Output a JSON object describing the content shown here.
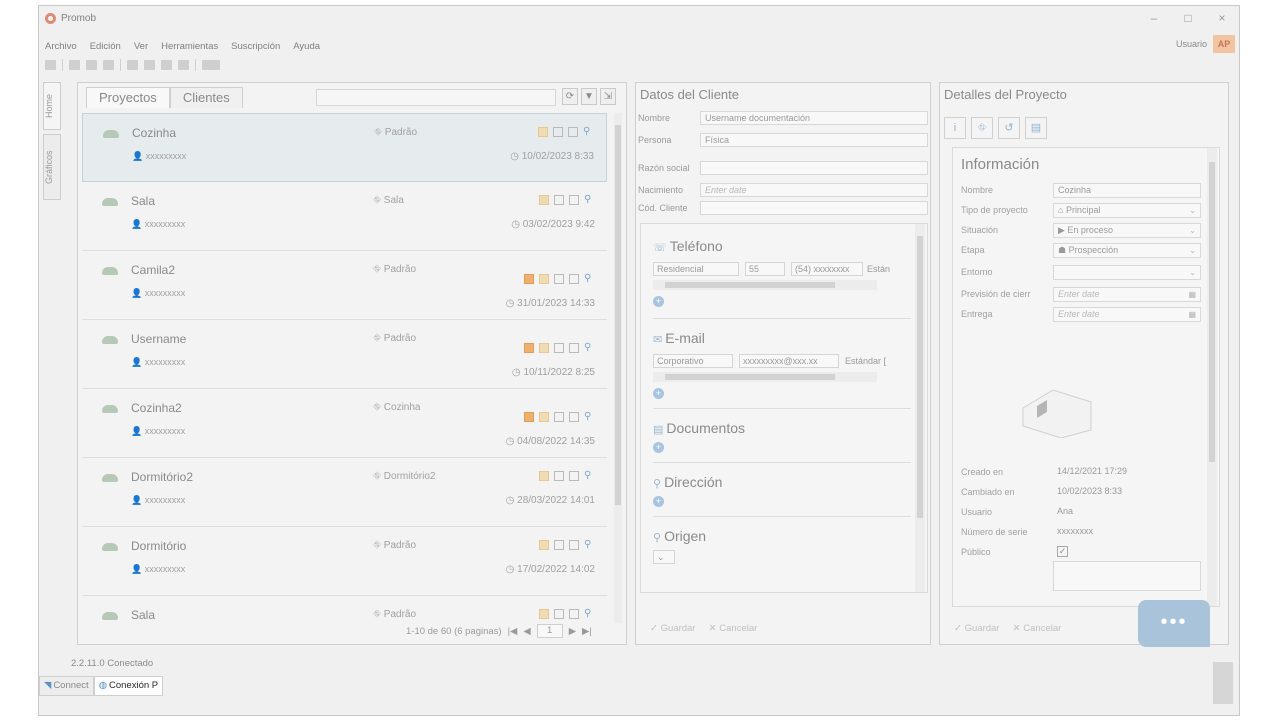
{
  "window": {
    "title": "Promob",
    "controls": [
      "–",
      "□",
      "×"
    ]
  },
  "menu": [
    "Archivo",
    "Edición",
    "Ver",
    "Herramientas",
    "Suscripción",
    "Ayuda"
  ],
  "user": {
    "label": "Usuario",
    "avatar": "AP"
  },
  "side_tabs": {
    "home": "Home",
    "graficos": "Gráficos"
  },
  "projects": {
    "tabs": [
      "Proyectos",
      "Clientes"
    ],
    "rows": [
      {
        "name": "Cozinha",
        "owner": "xxxxxxxxx",
        "environment": "Padrão",
        "date": "10/02/2023 8:33",
        "selected": true,
        "person": false
      },
      {
        "name": "Sala",
        "owner": "xxxxxxxxx",
        "environment": "Sala",
        "date": "03/02/2023 9:42",
        "selected": false,
        "person": false
      },
      {
        "name": "Camila2",
        "owner": "xxxxxxxxx",
        "environment": "Padrão",
        "date": "31/01/2023 14:33",
        "selected": false,
        "person": true
      },
      {
        "name": "Username",
        "owner": "xxxxxxxxx",
        "environment": "Padrão",
        "date": "10/11/2022 8:25",
        "selected": false,
        "person": true
      },
      {
        "name": "Cozinha2",
        "owner": "xxxxxxxxx",
        "environment": "Cozinha",
        "date": "04/08/2022 14:35",
        "selected": false,
        "person": true
      },
      {
        "name": "Dormitório2",
        "owner": "xxxxxxxxx",
        "environment": "Dormitório2",
        "date": "28/03/2022 14:01",
        "selected": false,
        "person": false
      },
      {
        "name": "Dormitório",
        "owner": "xxxxxxxxx",
        "environment": "Padrão",
        "date": "17/02/2022 14:02",
        "selected": false,
        "person": false
      },
      {
        "name": "Sala",
        "owner": "",
        "environment": "Padrão",
        "date": "",
        "selected": false,
        "person": false
      }
    ],
    "pager": {
      "summary": "1-10 de 60 (6 paginas)",
      "page": "1"
    }
  },
  "client": {
    "title": "Datos del Cliente",
    "fields": {
      "nombre_label": "Nombre",
      "nombre_value": "Username documentación",
      "persona_label": "Persona",
      "persona_value": "Física",
      "razon_label": "Razón social",
      "nacimiento_label": "Nacimiento",
      "nacimiento_placeholder": "Enter date",
      "cod_label": "Cód. Cliente"
    },
    "telefono": {
      "title": "Teléfono",
      "type": "Residencial",
      "code": "55",
      "number": "(54) xxxxxxxx",
      "status": "Están"
    },
    "email": {
      "title": "E-mail",
      "type": "Corporativo",
      "address": "xxxxxxxxx@xxx.xx",
      "status": "Estándar ["
    },
    "documentos": "Documentos",
    "direccion": "Dirección",
    "origen": "Origen",
    "actions": {
      "save": "Guardar",
      "cancel": "Cancelar"
    }
  },
  "details": {
    "title": "Detalles del Proyecto",
    "section": "Información",
    "fields": {
      "nombre_label": "Nombre",
      "nombre_value": "Cozinha",
      "tipo_label": "Tipo de proyecto",
      "tipo_value": "Principal",
      "situacion_label": "Situación",
      "situacion_value": "En proceso",
      "etapa_label": "Etapa",
      "etapa_value": "Prospección",
      "entorno_label": "Entorno",
      "prevision_label": "Previsión de cierr",
      "prevision_placeholder": "Enter date",
      "entrega_label": "Entrega",
      "entrega_placeholder": "Enter date",
      "creado_label": "Creado en",
      "creado_value": "14/12/2021 17:29",
      "cambiado_label": "Cambiado en",
      "cambiado_value": "10/02/2023 8:33",
      "usuario_label": "Usuario",
      "usuario_value": "Ana",
      "serie_label": "Número de serie",
      "serie_value": "xxxxxxxx",
      "publico_label": "Público"
    },
    "actions": {
      "save": "Guardar",
      "cancel": "Cancelar"
    }
  },
  "chat_button": "•••",
  "status": {
    "text": "2.2.11.0 Conectado"
  },
  "bottom_tabs": [
    "Connect",
    "Conexión P"
  ],
  "colors": {
    "accent": "#a9c4da",
    "avatar_bg": "#f2c4a2"
  }
}
